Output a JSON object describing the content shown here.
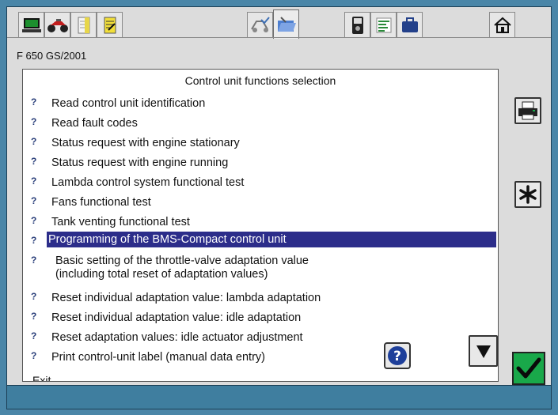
{
  "vehicle": "F 650 GS/2001",
  "list": {
    "title": "Control unit functions selection",
    "items": [
      {
        "label": "Read control unit identification"
      },
      {
        "label": "Read fault codes"
      },
      {
        "label": "Status request with engine stationary"
      },
      {
        "label": "Status request with engine running"
      },
      {
        "label": "Lambda control system functional test"
      },
      {
        "label": "Fans functional test"
      },
      {
        "label": "Tank venting functional test"
      },
      {
        "label": "Programming of the BMS-Compact control unit",
        "selected": true
      },
      {
        "label_line1": "Basic setting of the throttle-valve adaptation value",
        "label_line2": "(including total reset of adaptation values)"
      },
      {
        "label": "Reset individual adaptation value: lambda adaptation"
      },
      {
        "label": "Reset individual adaptation value: idle adaptation"
      },
      {
        "label": "Reset adaptation values: idle actuator adjustment"
      },
      {
        "label": "Print control-unit label (manual data entry)"
      }
    ],
    "exit": "Exit"
  },
  "colors": {
    "background": "#4a86a8",
    "window": "#dcdcdc",
    "selection": "#2c2d8a",
    "ok_button": "#19a84a"
  },
  "icons": {
    "tabs": [
      "monitor-icon",
      "motorcycle-icon",
      "notepad-icon",
      "edit-note-icon",
      "vehicle-check-icon",
      "open-folder-icon",
      "measuring-device-icon",
      "list-icon",
      "briefcase-icon",
      "home-icon"
    ],
    "print": "printer-icon",
    "asterisk": "asterisk-icon",
    "help": "help-icon",
    "scroll_down": "down-arrow-icon",
    "ok": "checkmark-icon",
    "item": "question-mark-icon"
  }
}
